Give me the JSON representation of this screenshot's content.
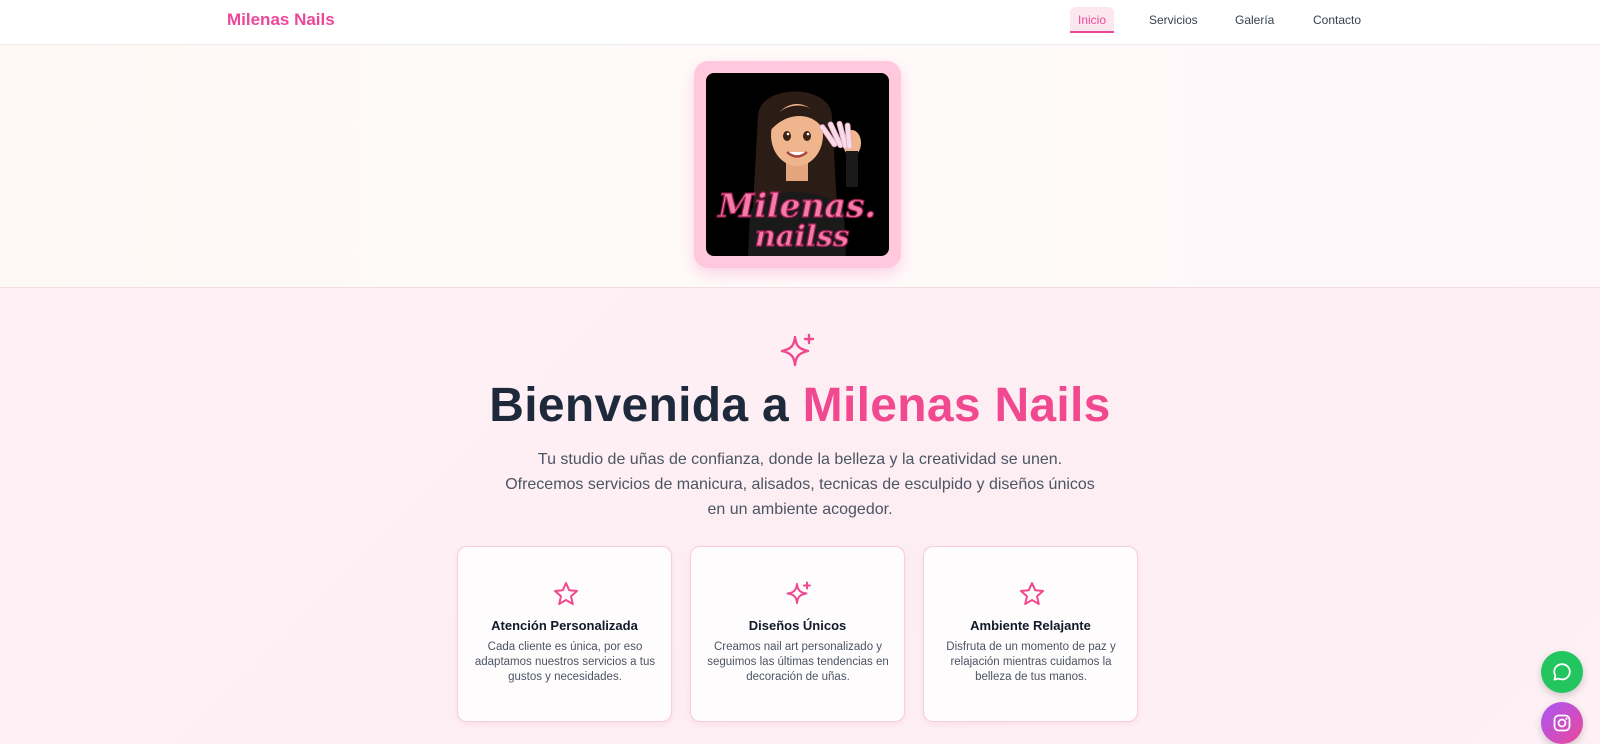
{
  "nav": {
    "brand": "Milenas Nails",
    "items": [
      {
        "label": "Inicio",
        "active": true
      },
      {
        "label": "Servicios",
        "active": false
      },
      {
        "label": "Galería",
        "active": false
      },
      {
        "label": "Contacto",
        "active": false
      }
    ]
  },
  "hero": {
    "logo_text_line1": "Milenas.",
    "logo_text_line2": "nailss"
  },
  "welcome": {
    "title_prefix": "Bienvenida a",
    "title_accent": "Milenas Nails",
    "description": "Tu studio de uñas de confianza, donde la belleza y la creatividad se unen. Ofrecemos servicios de manicura, alisados, tecnicas de esculpido y diseños únicos en un ambiente acogedor."
  },
  "features": [
    {
      "icon": "star-icon",
      "title": "Atención Personalizada",
      "text": "Cada cliente es única, por eso adaptamos nuestros servicios a tus gustos y necesidades."
    },
    {
      "icon": "sparkles-icon",
      "title": "Diseños Únicos",
      "text": "Creamos nail art personalizado y seguimos las últimas tendencias en decoración de uñas."
    },
    {
      "icon": "star-icon",
      "title": "Ambiente Relajante",
      "text": "Disfruta de un momento de paz y relajación mientras cuidamos la belleza de tus manos."
    }
  ],
  "colors": {
    "brand_pink": "#ec4899",
    "whatsapp_green": "#22c55e",
    "instagram_gradient_start": "#a855f7"
  }
}
